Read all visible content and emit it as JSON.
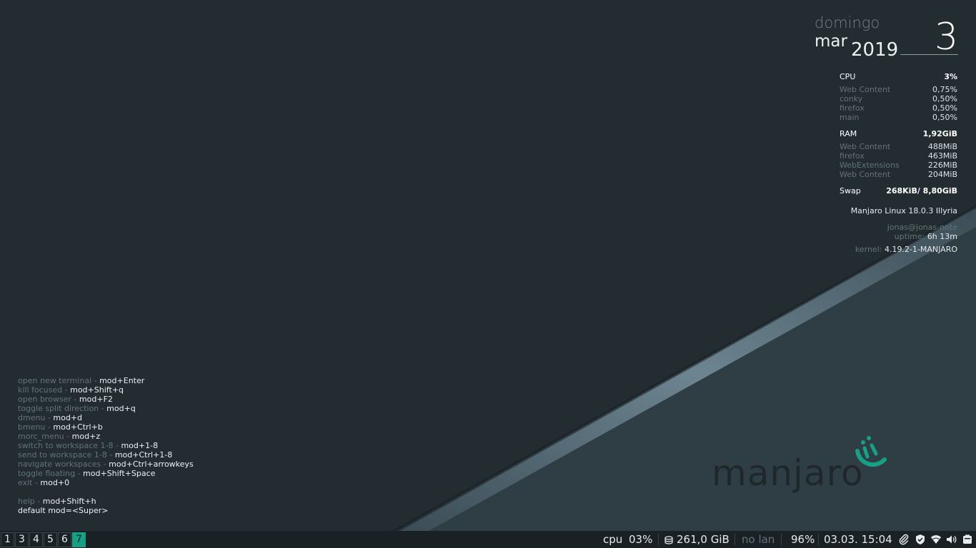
{
  "conky": {
    "dayname": "domingo",
    "month": "mar",
    "year": "2019",
    "day": "3",
    "cpu": {
      "label": "CPU",
      "total": "3%",
      "processes": [
        {
          "name": "Web Content",
          "value": "0,75%"
        },
        {
          "name": "conky",
          "value": "0,50%"
        },
        {
          "name": "firefox",
          "value": "0,50%"
        },
        {
          "name": "main",
          "value": "0,50%"
        }
      ]
    },
    "ram": {
      "label": "RAM",
      "total": "1,92GiB",
      "processes": [
        {
          "name": "Web Content",
          "value": "488MiB"
        },
        {
          "name": "firefox",
          "value": "463MiB"
        },
        {
          "name": "WebExtensions",
          "value": "226MiB"
        },
        {
          "name": "Web Content",
          "value": "204MiB"
        }
      ]
    },
    "swap": {
      "label": "Swap",
      "value": "268KiB/ 8,80GiB"
    },
    "distro": "Manjaro Linux 18.0.3 Illyria",
    "user_host": "jonas@jonas-note",
    "uptime_label": "uptime:",
    "uptime_value": "6h 13m",
    "kernel_label": "kernel:",
    "kernel_value": "4.19.2-1-MANJARO"
  },
  "keybinds": [
    {
      "desc": "open new terminal - ",
      "key": "mod+Enter"
    },
    {
      "desc": "kill focused - ",
      "key": "mod+Shift+q"
    },
    {
      "desc": "open browser - ",
      "key": "mod+F2"
    },
    {
      "desc": "toggle split direction - ",
      "key": "mod+q"
    },
    {
      "desc": "dmenu - ",
      "key": "mod+d"
    },
    {
      "desc": "bmenu - ",
      "key": "mod+Ctrl+b"
    },
    {
      "desc": "morc_menu - ",
      "key": "mod+z"
    },
    {
      "desc": "switch to workspace 1-8 - ",
      "key": "mod+1-8"
    },
    {
      "desc": "send to workspace 1-8 - ",
      "key": "mod+Ctrl+1-8"
    },
    {
      "desc": "navigate workspaces - ",
      "key": "mod+Ctrl+arrowkeys"
    },
    {
      "desc": "toggle floating - ",
      "key": "mod+Shift+Space"
    },
    {
      "desc": "exit - ",
      "key": "mod+0"
    },
    {
      "desc": "",
      "key": ""
    },
    {
      "desc": "help - ",
      "key": "mod+Shift+h"
    },
    {
      "desc": "",
      "key": "default mod=<Super>"
    }
  ],
  "logo": {
    "text": "manjaro"
  },
  "bar": {
    "workspaces": [
      "1",
      "3",
      "4",
      "5",
      "6",
      "7"
    ],
    "active_workspace": "7",
    "cpu_label": "cpu",
    "cpu_value": "03%",
    "disk": "261,0 GiB",
    "lan": "no lan",
    "battery": "96%",
    "datetime": "03.03. 15:04",
    "tray_icons": [
      "paperclip-icon",
      "shield-icon",
      "wifi-icon",
      "volume-icon",
      "battery-tray-icon"
    ]
  },
  "colors": {
    "accent": "#16a085",
    "background": "#222b30",
    "panel": "#1a2125",
    "muted_text": "#61737b"
  }
}
